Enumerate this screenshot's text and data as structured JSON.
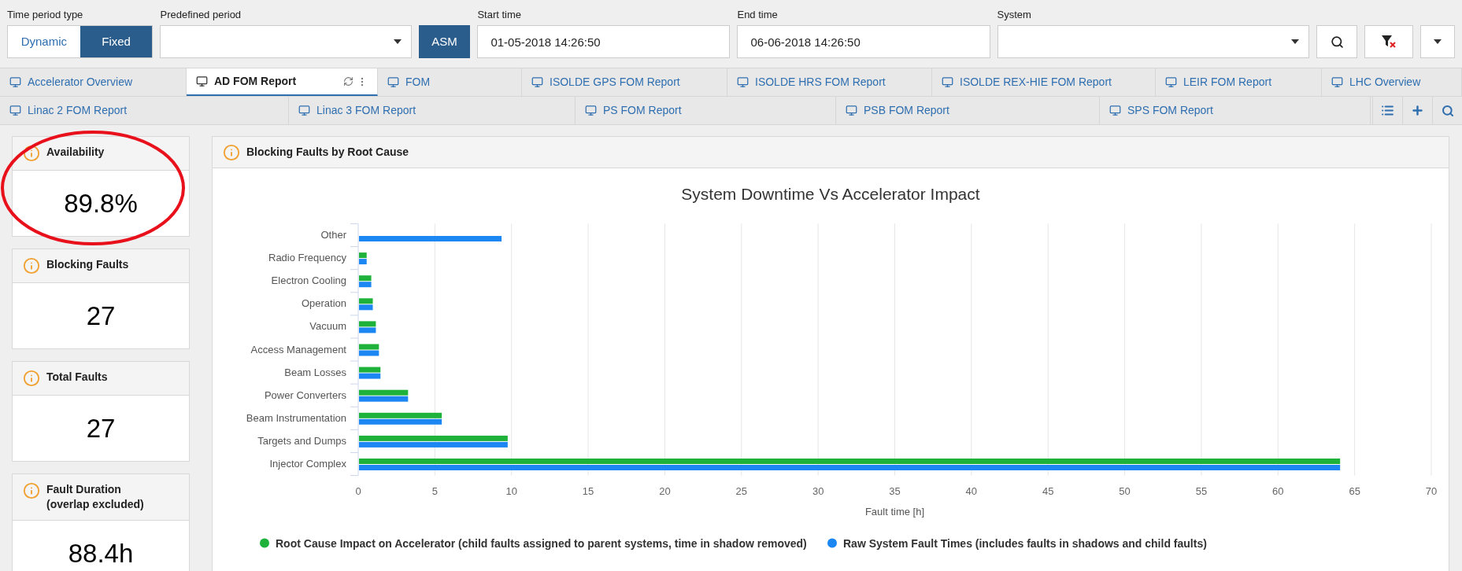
{
  "filters": {
    "time_period_type": {
      "label": "Time period type",
      "options": [
        {
          "label": "Dynamic",
          "selected": false
        },
        {
          "label": "Fixed",
          "selected": true
        }
      ]
    },
    "predefined_period": {
      "label": "Predefined period"
    },
    "asm_button": "ASM",
    "start_time": {
      "label": "Start time",
      "value": "01-05-2018 14:26:50"
    },
    "end_time": {
      "label": "End time",
      "value": "06-06-2018 14:26:50"
    },
    "system": {
      "label": "System"
    }
  },
  "tab_rows": [
    [
      {
        "label": "Accelerator Overview",
        "selected": false
      },
      {
        "label": "AD FOM Report",
        "selected": true
      },
      {
        "label": "FOM",
        "selected": false
      },
      {
        "label": "ISOLDE GPS FOM Report",
        "selected": false
      },
      {
        "label": "ISOLDE HRS FOM Report",
        "selected": false
      },
      {
        "label": "ISOLDE REX-HIE FOM Report",
        "selected": false
      },
      {
        "label": "LEIR FOM Report",
        "selected": false
      },
      {
        "label": "LHC Overview",
        "selected": false
      }
    ],
    [
      {
        "label": "Linac 2 FOM Report",
        "selected": false
      },
      {
        "label": "Linac 3 FOM Report",
        "selected": false
      },
      {
        "label": "PS FOM Report",
        "selected": false
      },
      {
        "label": "PSB FOM Report",
        "selected": false
      },
      {
        "label": "SPS FOM Report",
        "selected": false
      }
    ]
  ],
  "kpi_cards": [
    {
      "title_lines": [
        "Availability"
      ],
      "value": "89.8%"
    },
    {
      "title_lines": [
        "Blocking Faults"
      ],
      "value": "27"
    },
    {
      "title_lines": [
        "Total Faults"
      ],
      "value": "27"
    },
    {
      "title_lines": [
        "Fault Duration",
        "(overlap excluded)"
      ],
      "value": "88.4h"
    }
  ],
  "chart_panel": {
    "title": "Blocking Faults by Root Cause",
    "chart_data": {
      "type": "bar",
      "orientation": "horizontal",
      "title": "System Downtime Vs Accelerator Impact",
      "xlabel": "Fault time [h]",
      "categories": [
        "Other",
        "Radio Frequency",
        "Electron Cooling",
        "Operation",
        "Vacuum",
        "Access Management",
        "Beam Losses",
        "Power Converters",
        "Beam Instrumentation",
        "Targets and Dumps",
        "Injector Complex"
      ],
      "series": [
        {
          "name": "Root Cause Impact on Accelerator (child faults assigned to parent systems, time in shadow removed)",
          "color": "#1fb23a",
          "values": [
            0,
            0.5,
            0.8,
            0.9,
            1.1,
            1.3,
            1.4,
            3.2,
            5.4,
            9.7,
            64
          ]
        },
        {
          "name": "Raw System Fault Times (includes faults in shadows and child faults)",
          "color": "#1c86f2",
          "values": [
            9.3,
            0.5,
            0.8,
            0.9,
            1.1,
            1.3,
            1.4,
            3.2,
            5.4,
            9.7,
            64
          ]
        }
      ],
      "grid": true,
      "legend": true,
      "xlim": [
        0,
        70
      ],
      "xticks": [
        0,
        5,
        10,
        15,
        20,
        25,
        30,
        35,
        40,
        45,
        50,
        55,
        60,
        65,
        70
      ]
    }
  }
}
